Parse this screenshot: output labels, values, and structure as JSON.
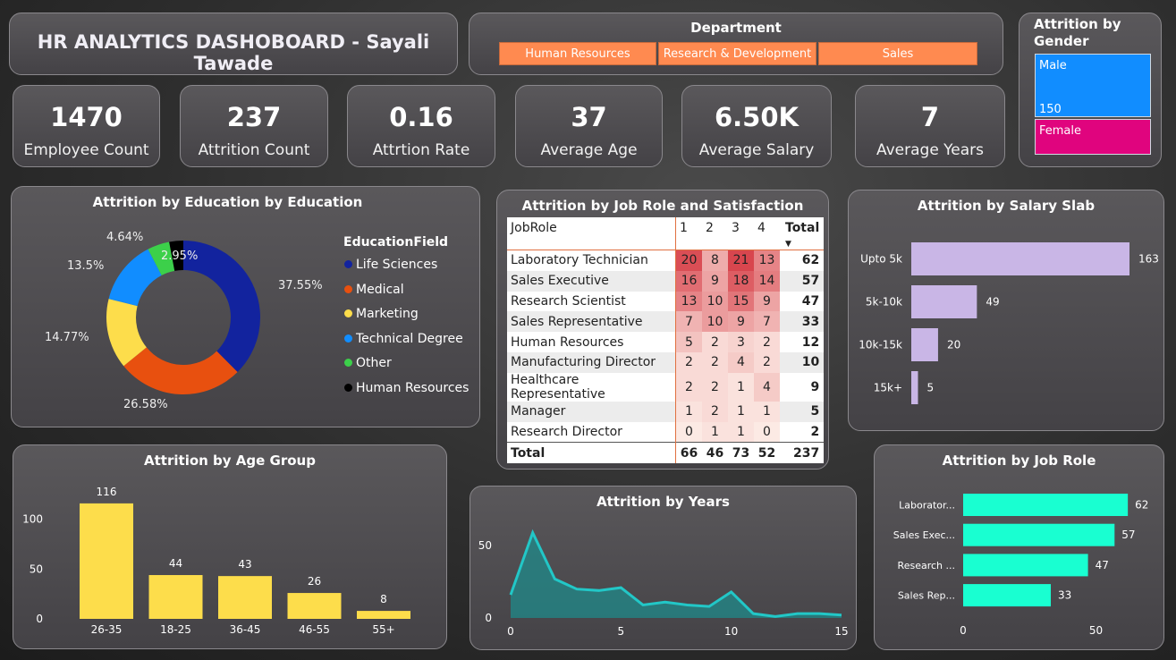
{
  "title": "HR ANALYTICS DASHOBOARD - Sayali Tawade",
  "department": {
    "title": "Department",
    "options": [
      "Human Resources",
      "Research & Development",
      "Sales"
    ]
  },
  "kpis": [
    {
      "value": "1470",
      "label": "Employee Count"
    },
    {
      "value": "237",
      "label": "Attrition Count"
    },
    {
      "value": "0.16",
      "label": "Attrtion Rate"
    },
    {
      "value": "37",
      "label": "Average Age"
    },
    {
      "value": "6.50K",
      "label": "Average Salary"
    },
    {
      "value": "7",
      "label": "Average Years"
    }
  ],
  "gender": {
    "title": "Attrition by Gender",
    "male_label": "Male",
    "male_value": "150",
    "male_color": "#118dff",
    "female_label": "Female",
    "female_color": "#e0047e"
  },
  "chart_data": [
    {
      "type": "pie",
      "title": "Attrition by Education by Education",
      "legend_title": "EducationField",
      "legend_position": "right",
      "categories": [
        "Life Sciences",
        "Medical",
        "Marketing",
        "Technical Degree",
        "Other",
        "Human Resources"
      ],
      "values": [
        37.55,
        26.58,
        14.77,
        13.5,
        4.64,
        2.95
      ],
      "labels": [
        "37.55%",
        "26.58%",
        "14.77%",
        "13.5%",
        "4.64%",
        "2.95%"
      ],
      "colors": [
        "#12239e",
        "#e8500f",
        "#fddd4b",
        "#118dff",
        "#3cd04a",
        "#000000"
      ]
    },
    {
      "type": "table",
      "title": "Attrition by Job Role and Satisfaction",
      "row_header": "JobRole",
      "columns": [
        "1",
        "2",
        "3",
        "4"
      ],
      "total_label": "Total",
      "rows": [
        {
          "role": "Laboratory Technician",
          "values": [
            20,
            8,
            21,
            13
          ],
          "total": 62
        },
        {
          "role": "Sales Executive",
          "values": [
            16,
            9,
            18,
            14
          ],
          "total": 57
        },
        {
          "role": "Research Scientist",
          "values": [
            13,
            10,
            15,
            9
          ],
          "total": 47
        },
        {
          "role": "Sales Representative",
          "values": [
            7,
            10,
            9,
            7
          ],
          "total": 33
        },
        {
          "role": "Human Resources",
          "values": [
            5,
            2,
            3,
            2
          ],
          "total": 12
        },
        {
          "role": "Manufacturing Director",
          "values": [
            2,
            2,
            4,
            2
          ],
          "total": 10
        },
        {
          "role": "Healthcare Representative",
          "values": [
            2,
            2,
            1,
            4
          ],
          "total": 9
        },
        {
          "role": "Manager",
          "values": [
            1,
            2,
            1,
            1
          ],
          "total": 5
        },
        {
          "role": "Research Director",
          "values": [
            0,
            1,
            1,
            0
          ],
          "total": 2
        }
      ],
      "column_totals": [
        66,
        46,
        73,
        52
      ],
      "grand_total": 237
    },
    {
      "type": "bar",
      "orientation": "horizontal",
      "title": "Attrition by Salary Slab",
      "categories": [
        "Upto 5k",
        "5k-10k",
        "10k-15k",
        "15k+"
      ],
      "values": [
        163,
        49,
        20,
        5
      ],
      "color": "#c9b6e6"
    },
    {
      "type": "bar",
      "title": "Attrition by Age Group",
      "categories": [
        "26-35",
        "18-25",
        "36-45",
        "46-55",
        "55+"
      ],
      "values": [
        116,
        44,
        43,
        26,
        8
      ],
      "yticks": [
        0,
        50,
        100
      ],
      "ylim": [
        0,
        125
      ],
      "color": "#fddd4b"
    },
    {
      "type": "area",
      "title": "Attrition by Years",
      "x": [
        0,
        1,
        2,
        3,
        4,
        5,
        6,
        7,
        8,
        9,
        10,
        11,
        12,
        13,
        14,
        15
      ],
      "values": [
        16,
        59,
        27,
        20,
        19,
        21,
        9,
        11,
        9,
        8,
        18,
        3,
        1,
        3,
        3,
        2
      ],
      "xticks": [
        0,
        5,
        10,
        15
      ],
      "yticks": [
        0,
        50
      ],
      "xlim": [
        0,
        15
      ],
      "ylim": [
        0,
        65
      ],
      "color": "#2dbfbf"
    },
    {
      "type": "bar",
      "orientation": "horizontal",
      "title": "Attrition by Job Role",
      "categories": [
        "Laborator...",
        "Sales Exec...",
        "Research ...",
        "Sales Rep..."
      ],
      "values": [
        62,
        57,
        47,
        33
      ],
      "xticks": [
        0,
        50
      ],
      "xlim": [
        0,
        65
      ],
      "color": "#19ffd1"
    }
  ]
}
